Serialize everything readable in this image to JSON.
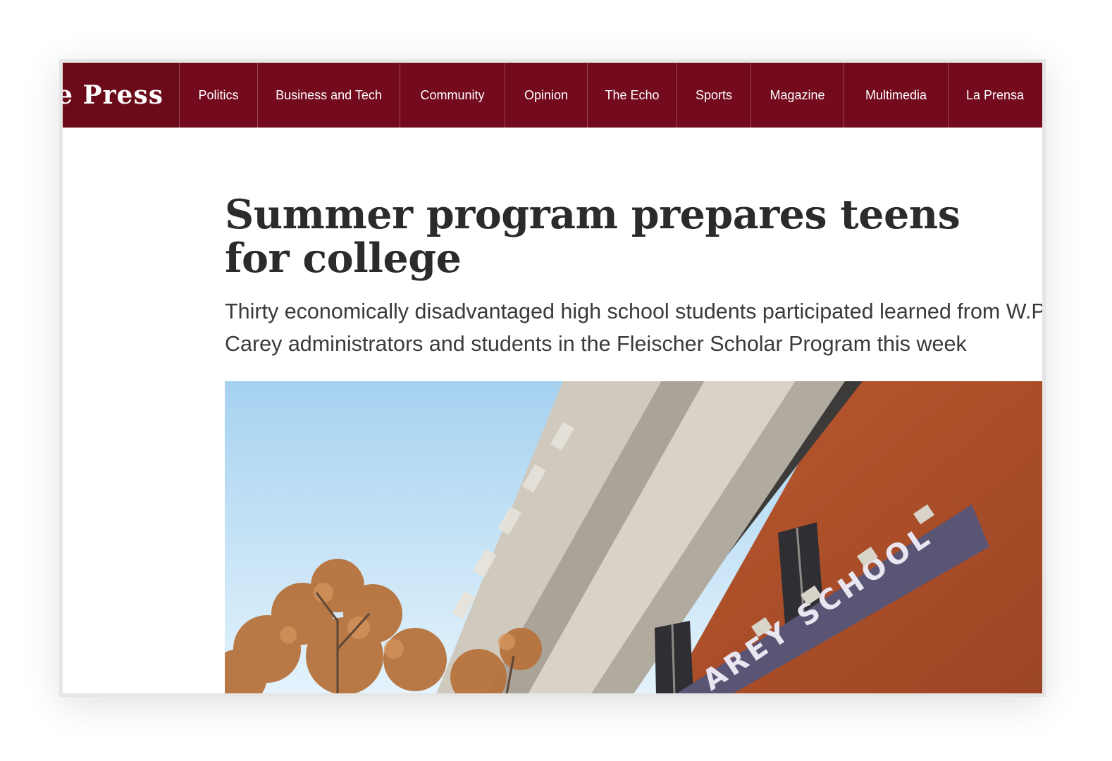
{
  "logo": {
    "text": "te Press"
  },
  "nav": {
    "items": [
      {
        "label": "Politics",
        "width": 111
      },
      {
        "label": "Business and Tech",
        "width": 202
      },
      {
        "label": "Community",
        "width": 149
      },
      {
        "label": "Opinion",
        "width": 117
      },
      {
        "label": "The Echo",
        "width": 127
      },
      {
        "label": "Sports",
        "width": 105
      },
      {
        "label": "Magazine",
        "width": 132
      },
      {
        "label": "Multimedia",
        "width": 148
      },
      {
        "label": "La Prensa",
        "width": 132
      }
    ]
  },
  "article": {
    "headline": "Summer program prepares teens for college",
    "subheadline": "Thirty economically disadvantaged high school students participated learned from W.P. Carey administrators and students in the Fleischer Scholar Program this week"
  },
  "photo": {
    "sign_text": "AREY SCHOOL",
    "colors": {
      "sky_top": "#a8d4f2",
      "sky_bottom": "#e0f1fc",
      "brick": "#b5552f",
      "concrete": "#c9c3b8",
      "sign": "#5a5475",
      "foliage": "#b8743f"
    }
  }
}
